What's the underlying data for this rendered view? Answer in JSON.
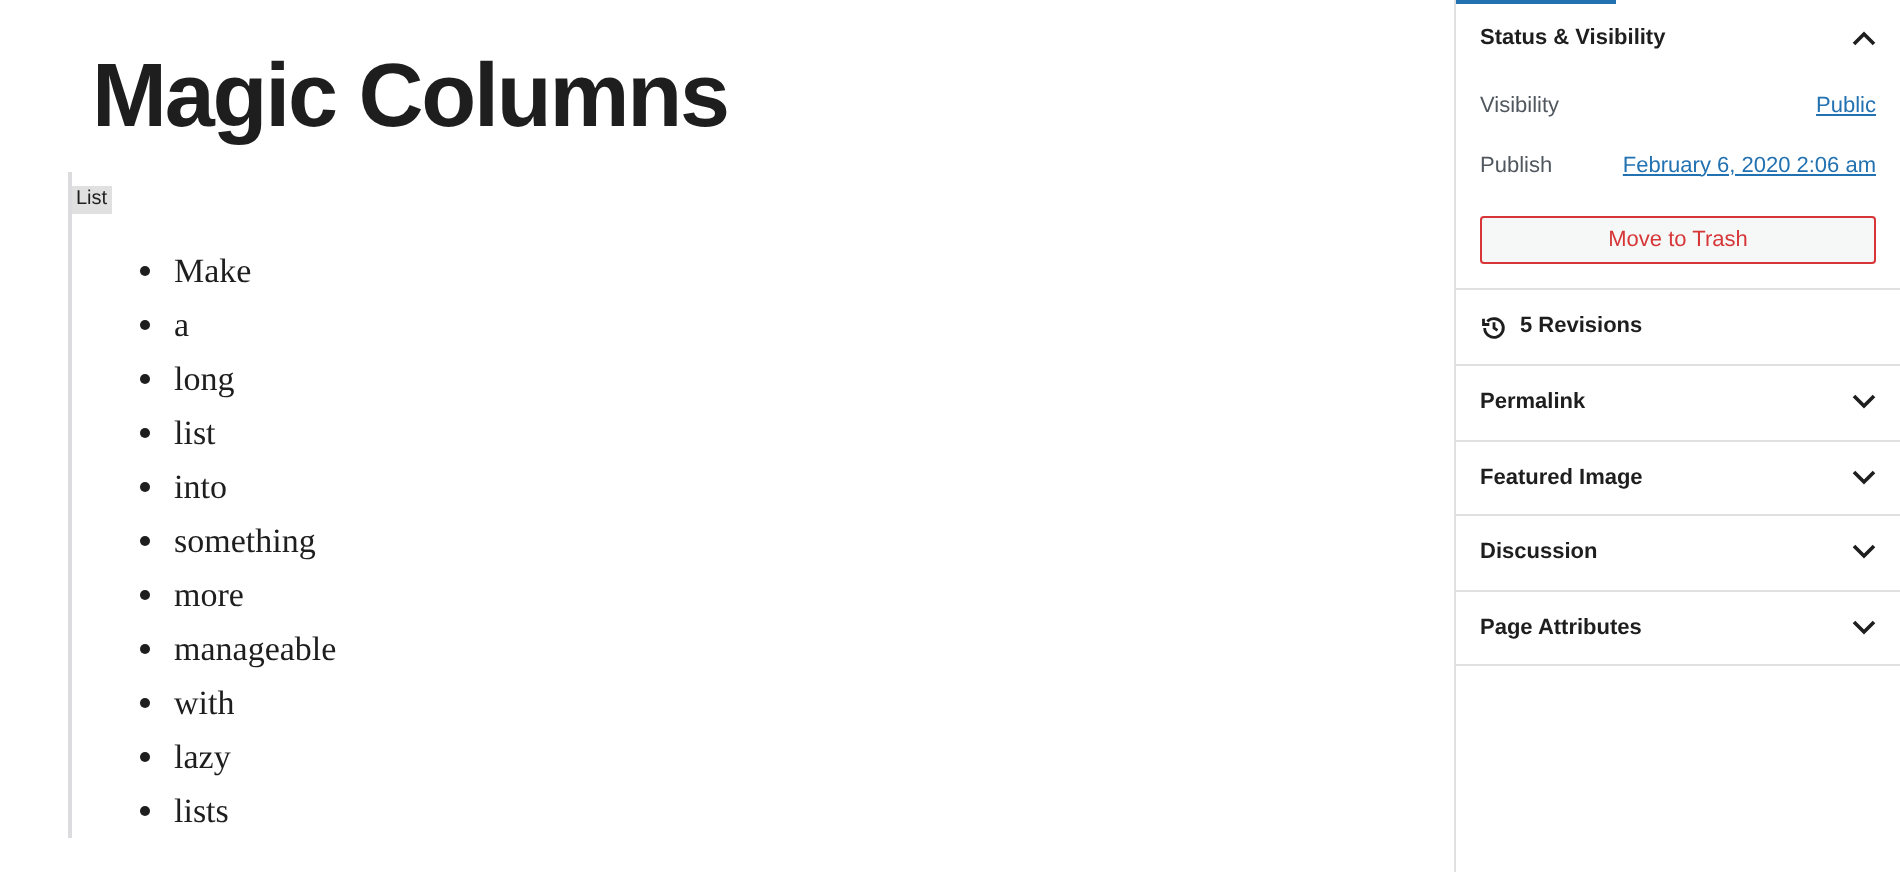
{
  "editor": {
    "title": "Magic Columns",
    "block_label": "List",
    "list_items": [
      "Make",
      "a",
      "long",
      "list",
      "into",
      "something",
      "more",
      "manageable",
      "with",
      "lazy",
      "lists"
    ]
  },
  "sidebar": {
    "status_panel": {
      "title": "Status & Visibility",
      "expanded": true,
      "rows": [
        {
          "label": "Visibility",
          "value": "Public"
        },
        {
          "label": "Publish",
          "value": "February 6, 2020 2:06 am"
        }
      ],
      "trash_button": "Move to Trash"
    },
    "revisions": "5 Revisions",
    "panels": [
      {
        "title": "Permalink",
        "expanded": false
      },
      {
        "title": "Featured Image",
        "expanded": false
      },
      {
        "title": "Discussion",
        "expanded": false
      },
      {
        "title": "Page Attributes",
        "expanded": false
      }
    ]
  }
}
